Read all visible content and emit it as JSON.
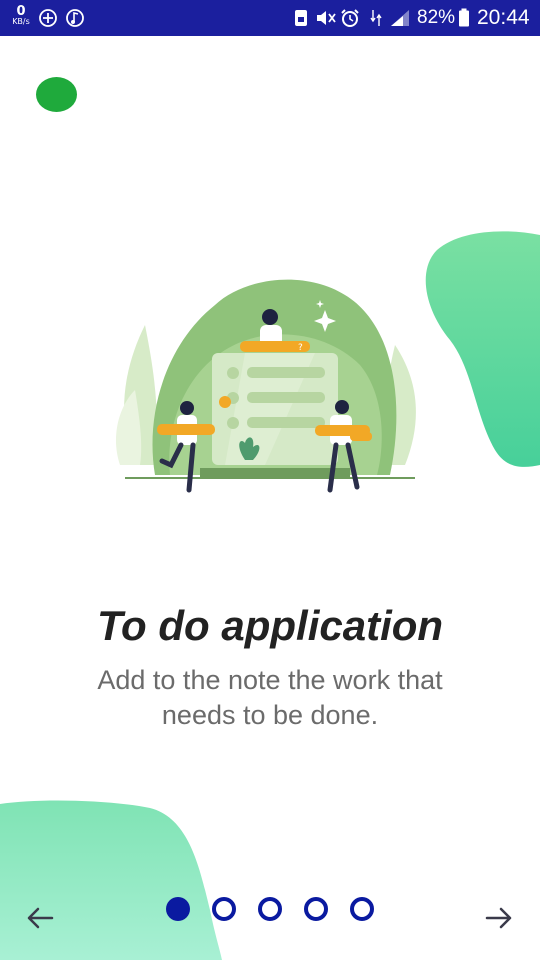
{
  "status_bar": {
    "net_speed_value": "0",
    "net_speed_unit": "KB/s",
    "battery_percent": "82%",
    "time": "20:44"
  },
  "onboarding": {
    "title": "To do application",
    "description": "Add to the note the work that needs to be done."
  },
  "pager": {
    "page_count": 5,
    "current_page": 1
  },
  "colors": {
    "status_bar": "#1b1f9e",
    "accent_dot": "#1faa3c",
    "blob_green": "#6fdfa6",
    "indicator": "#0a1aa0",
    "illustration_green": "#8fc27a"
  },
  "icons": {
    "back": "arrow-left-icon",
    "next": "arrow-right-icon"
  }
}
